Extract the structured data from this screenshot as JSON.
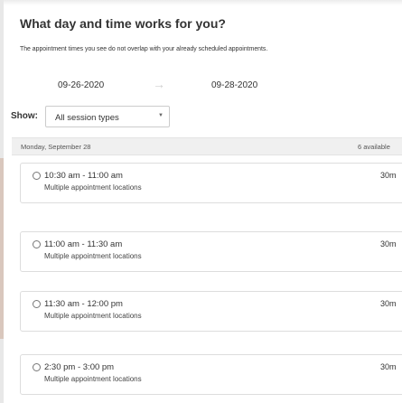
{
  "page": {
    "title": "What day and time works for you?",
    "notice": "The appointment times you see do not overlap with your already scheduled appointments."
  },
  "date_range": {
    "start": "09-26-2020",
    "end": "09-28-2020",
    "arrow_icon": "arrow-right-icon"
  },
  "filter": {
    "label": "Show:",
    "selected": "All session types",
    "caret_icon": "chevron-down-icon"
  },
  "day": {
    "label": "Monday, September 28",
    "available": "6 available"
  },
  "slots": [
    {
      "time": "10:30 am - 11:00 am",
      "location": "Multiple appointment locations",
      "duration": "30m"
    },
    {
      "time": "11:00 am - 11:30 am",
      "location": "Multiple appointment locations",
      "duration": "30m"
    },
    {
      "time": "11:30 am - 12:00 pm",
      "location": "Multiple appointment locations",
      "duration": "30m"
    },
    {
      "time": "2:30 pm - 3:00 pm",
      "location": "Multiple appointment locations",
      "duration": "30m"
    }
  ]
}
